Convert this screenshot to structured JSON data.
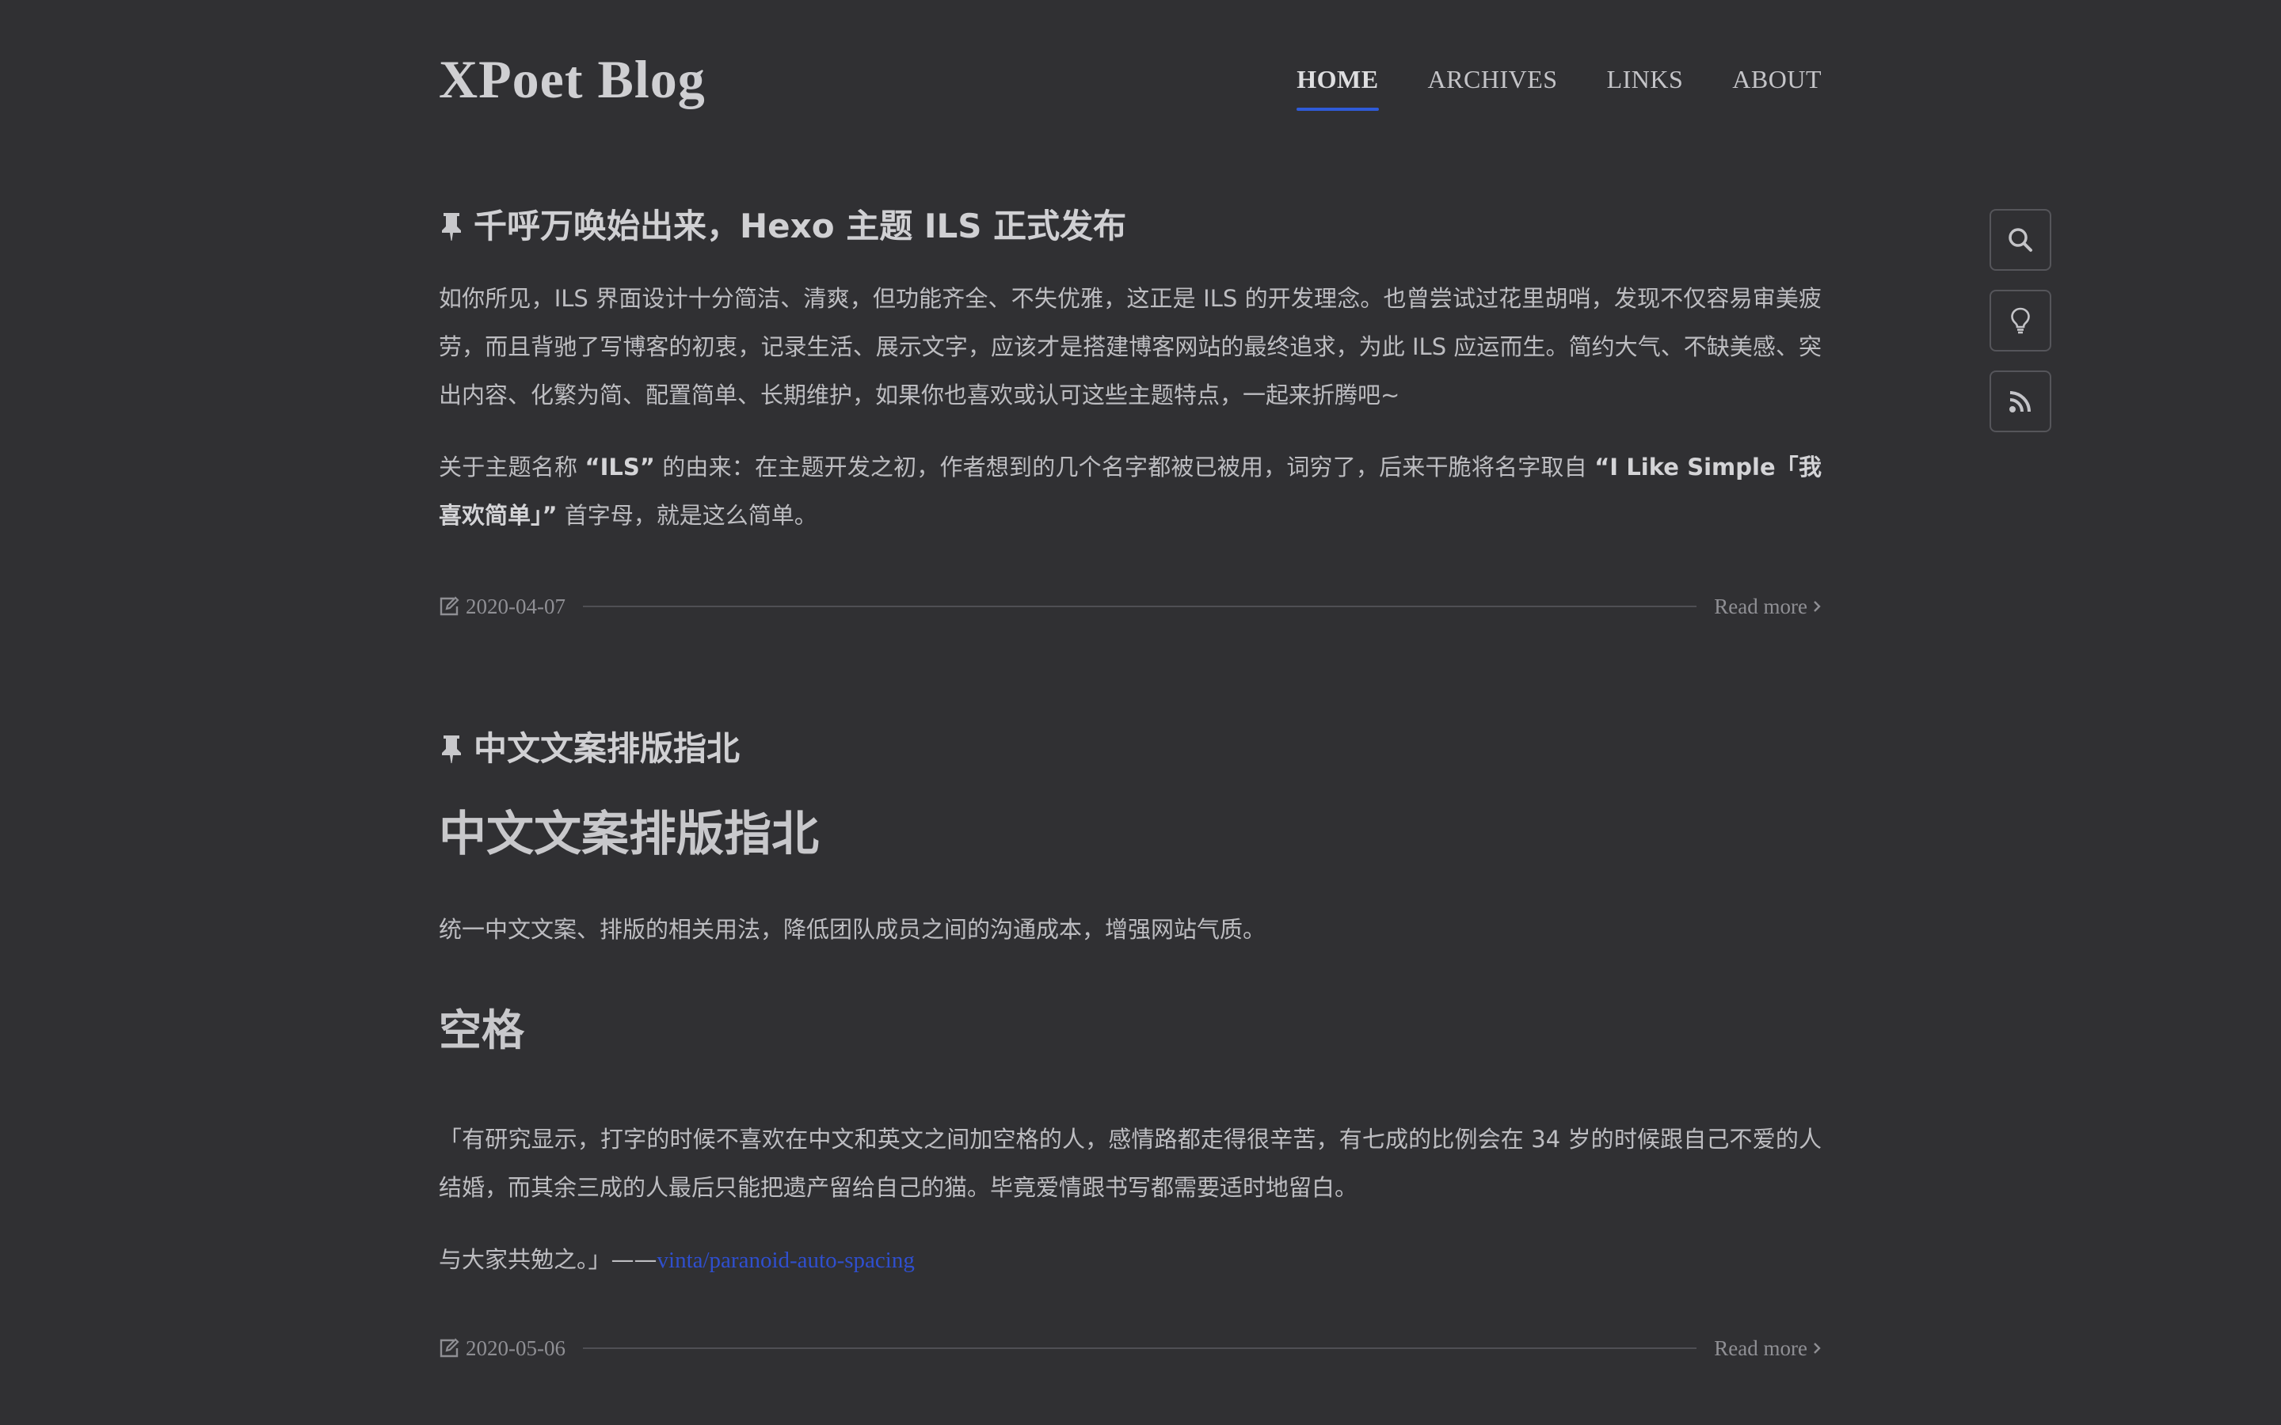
{
  "header": {
    "blog_title": "XPoet Blog",
    "nav": [
      {
        "label": "HOME",
        "active": true
      },
      {
        "label": "ARCHIVES",
        "active": false
      },
      {
        "label": "LINKS",
        "active": false
      },
      {
        "label": "ABOUT",
        "active": false
      }
    ]
  },
  "side_tools": [
    "search-icon",
    "lightbulb-icon",
    "rss-icon"
  ],
  "posts": [
    {
      "pinned": true,
      "title": "千呼万唤始出来，Hexo 主题 ILS 正式发布",
      "p1": "如你所见，ILS 界面设计十分简洁、清爽，但功能齐全、不失优雅，这正是 ILS 的开发理念。也曾尝试过花里胡哨，发现不仅容易审美疲劳，而且背驰了写博客的初衷，记录生活、展示文字，应该才是搭建博客网站的最终追求，为此 ILS 应运而生。简约大气、不缺美感、突出内容、化繁为简、配置简单、长期维护，如果你也喜欢或认可这些主题特点，一起来折腾吧~",
      "p2_a": "关于主题名称 ",
      "p2_b": "“ILS”",
      "p2_c": " 的由来：在主题开发之初，作者想到的几个名字都被已被用，词穷了，后来干脆将名字取自 ",
      "p2_d": "“I Like Simple「我喜欢简单」”",
      "p2_e": " 首字母，就是这么简单。",
      "date": "2020-04-07",
      "read_more": "Read more"
    },
    {
      "pinned": true,
      "title": "中文文案排版指北",
      "h1": "中文文案排版指北",
      "p1": "统一中文文案、排版的相关用法，降低团队成员之间的沟通成本，增强网站气质。",
      "h2": "空格",
      "p2": "「有研究显示，打字的时候不喜欢在中文和英文之间加空格的人，感情路都走得很辛苦，有七成的比例会在 34 岁的时候跟自己不爱的人结婚，而其余三成的人最后只能把遗产留给自己的猫。毕竟爱情跟书写都需要适时地留白。",
      "p3_prefix": "与大家共勉之。」——",
      "p3_link": "vinta/paranoid-auto-spacing",
      "date": "2020-05-06",
      "read_more": "Read more"
    }
  ],
  "colors": {
    "background": "#303033",
    "accent": "#2f5bd8",
    "link": "#2f4fcf"
  }
}
